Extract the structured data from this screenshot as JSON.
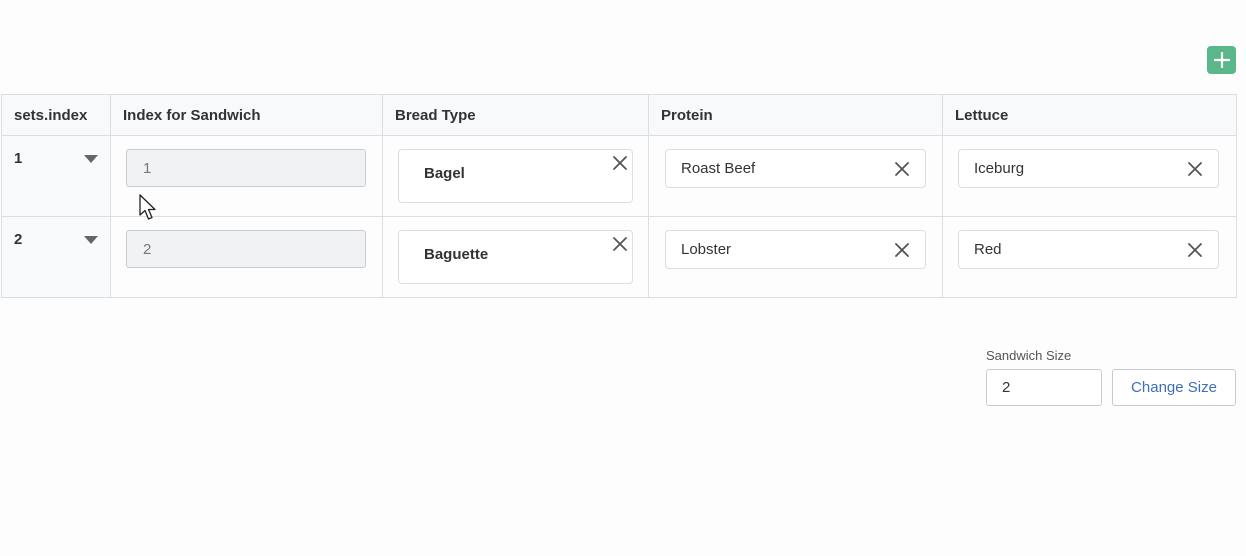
{
  "toolbar": {
    "add_icon": "plus-icon",
    "accent_color": "#59b78a"
  },
  "table": {
    "headers": [
      "sets.index",
      "Index for Sandwich",
      "Bread Type",
      "Protein",
      "Lettuce"
    ],
    "rows": [
      {
        "index": "1",
        "index_for_sandwich": "1",
        "bread_type": "Bagel",
        "protein": "Roast Beef",
        "lettuce": "Iceburg"
      },
      {
        "index": "2",
        "index_for_sandwich": "2",
        "bread_type": "Baguette",
        "protein": "Lobster",
        "lettuce": "Red"
      }
    ]
  },
  "size_control": {
    "label": "Sandwich Size",
    "value": "2",
    "button_label": "Change Size",
    "button_color": "#3d6fb6"
  },
  "icons": {
    "row_toggle": "caret-down-icon",
    "clear": "close-icon",
    "pointer": "mouse-cursor-icon"
  }
}
